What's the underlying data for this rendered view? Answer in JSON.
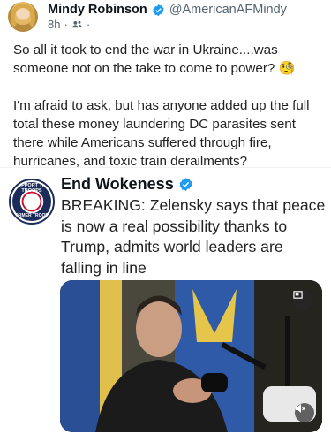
{
  "post": {
    "author_name": "Mindy Robinson",
    "handle": "@AmericanAFMindy",
    "time": "8h",
    "meta_separator": "·",
    "paragraph1": "So all it took to end the war in Ukraine....was someone not on the take to come to power? 🧐",
    "paragraph2": "I'm afraid to ask, but has anyone added up the full total these money laundering DC parasites sent there while Americans suffered through fire, hurricanes, and toxic train derailments?"
  },
  "quoted": {
    "author_name": "End Wokeness",
    "avatar_text_top": "SUPPORT THE TROOPS",
    "avatar_text_bottom": "FORMER TROOPS",
    "text": "BREAKING: Zelensky says that peace is now a real possibility thanks to Trump, admits world leaders are falling in line"
  },
  "icons": {
    "verified": "verified-badge-icon",
    "audience": "audience-icon",
    "expand": "expand-icon",
    "mute": "mute-icon"
  },
  "colors": {
    "verified": "#1d9bf0",
    "text": "#0f1419",
    "muted": "#536471"
  }
}
